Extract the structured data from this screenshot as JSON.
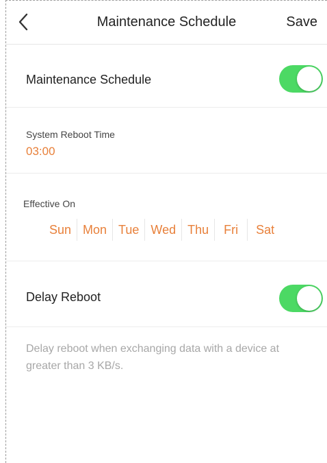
{
  "navbar": {
    "title": "Maintenance Schedule",
    "save_label": "Save",
    "back_icon": "chevron-left-icon"
  },
  "maintenance": {
    "label": "Maintenance Schedule",
    "enabled": true,
    "toggle_color": "#4cd964"
  },
  "reboot_time": {
    "label": "System Reboot Time",
    "value": "03:00",
    "value_color": "#e8803a"
  },
  "effective_on": {
    "label": "Effective On",
    "days": [
      "Sun",
      "Mon",
      "Tue",
      "Wed",
      "Thu",
      "Fri",
      "Sat"
    ],
    "day_color": "#e8803a"
  },
  "delay_reboot": {
    "label": "Delay Reboot",
    "enabled": true,
    "note": "Delay reboot when exchanging data with a device at greater than 3 KB/s."
  }
}
